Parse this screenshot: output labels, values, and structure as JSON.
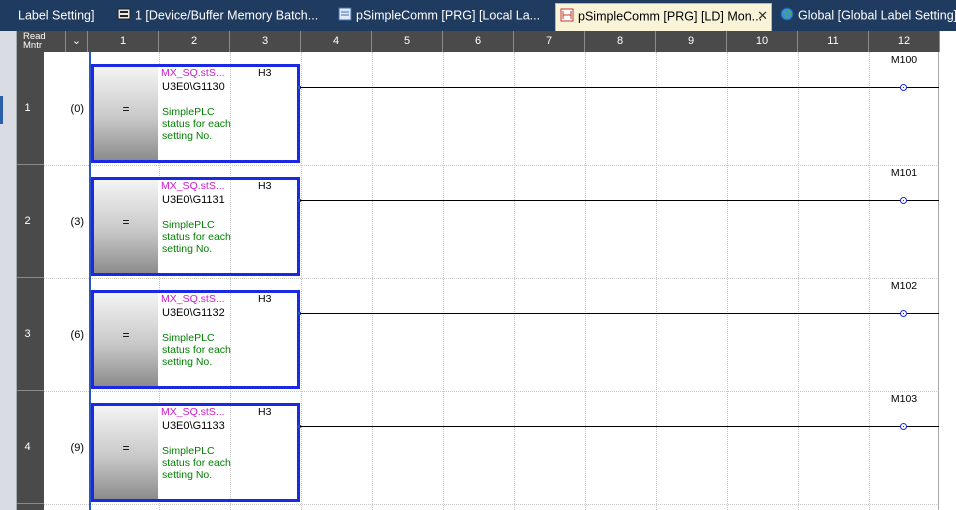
{
  "tabs": [
    {
      "label": "Label Setting]",
      "icon": "none",
      "active": false
    },
    {
      "label": "1 [Device/Buffer Memory Batch...",
      "icon": "device-memory-icon",
      "active": false
    },
    {
      "label": "pSimpleComm [PRG] [Local La...",
      "icon": "program-label-icon",
      "active": false
    },
    {
      "label": "pSimpleComm [PRG] [LD] Mon...",
      "icon": "ladder-program-icon",
      "active": true
    },
    {
      "label": "Global [Global Label Setting]",
      "icon": "globe-icon",
      "active": false
    }
  ],
  "tab_close": "✕",
  "ladder": {
    "corner_label": "Read\nMntr",
    "corner_arrow": "⌄",
    "columns": [
      "1",
      "2",
      "3",
      "4",
      "5",
      "6",
      "7",
      "8",
      "9",
      "10",
      "11",
      "12"
    ],
    "rungs": [
      {
        "row": "1",
        "step": "(0)",
        "op": "=",
        "var": "MX_SQ.stS...",
        "device": "U3E0\\G1130",
        "k": "H3",
        "comment": "SimplePLC status for each setting No.",
        "coil": "M100"
      },
      {
        "row": "2",
        "step": "(3)",
        "op": "=",
        "var": "MX_SQ.stS...",
        "device": "U3E0\\G1131",
        "k": "H3",
        "comment": "SimplePLC status for each setting No.",
        "coil": "M101"
      },
      {
        "row": "3",
        "step": "(6)",
        "op": "=",
        "var": "MX_SQ.stS...",
        "device": "U3E0\\G1132",
        "k": "H3",
        "comment": "SimplePLC status for each setting No.",
        "coil": "M102"
      },
      {
        "row": "4",
        "step": "(9)",
        "op": "=",
        "var": "MX_SQ.stS...",
        "device": "U3E0\\G1133",
        "k": "H3",
        "comment": "SimplePLC status for each setting No.",
        "coil": "M103"
      }
    ]
  },
  "colors": {
    "tabbar": "#1f3b60",
    "active_tab": "#f9f3d8",
    "header": "#4a4a4a",
    "function_block_border": "#1a29e6",
    "label_text": "#d01ad0",
    "comment_text": "#008000"
  }
}
